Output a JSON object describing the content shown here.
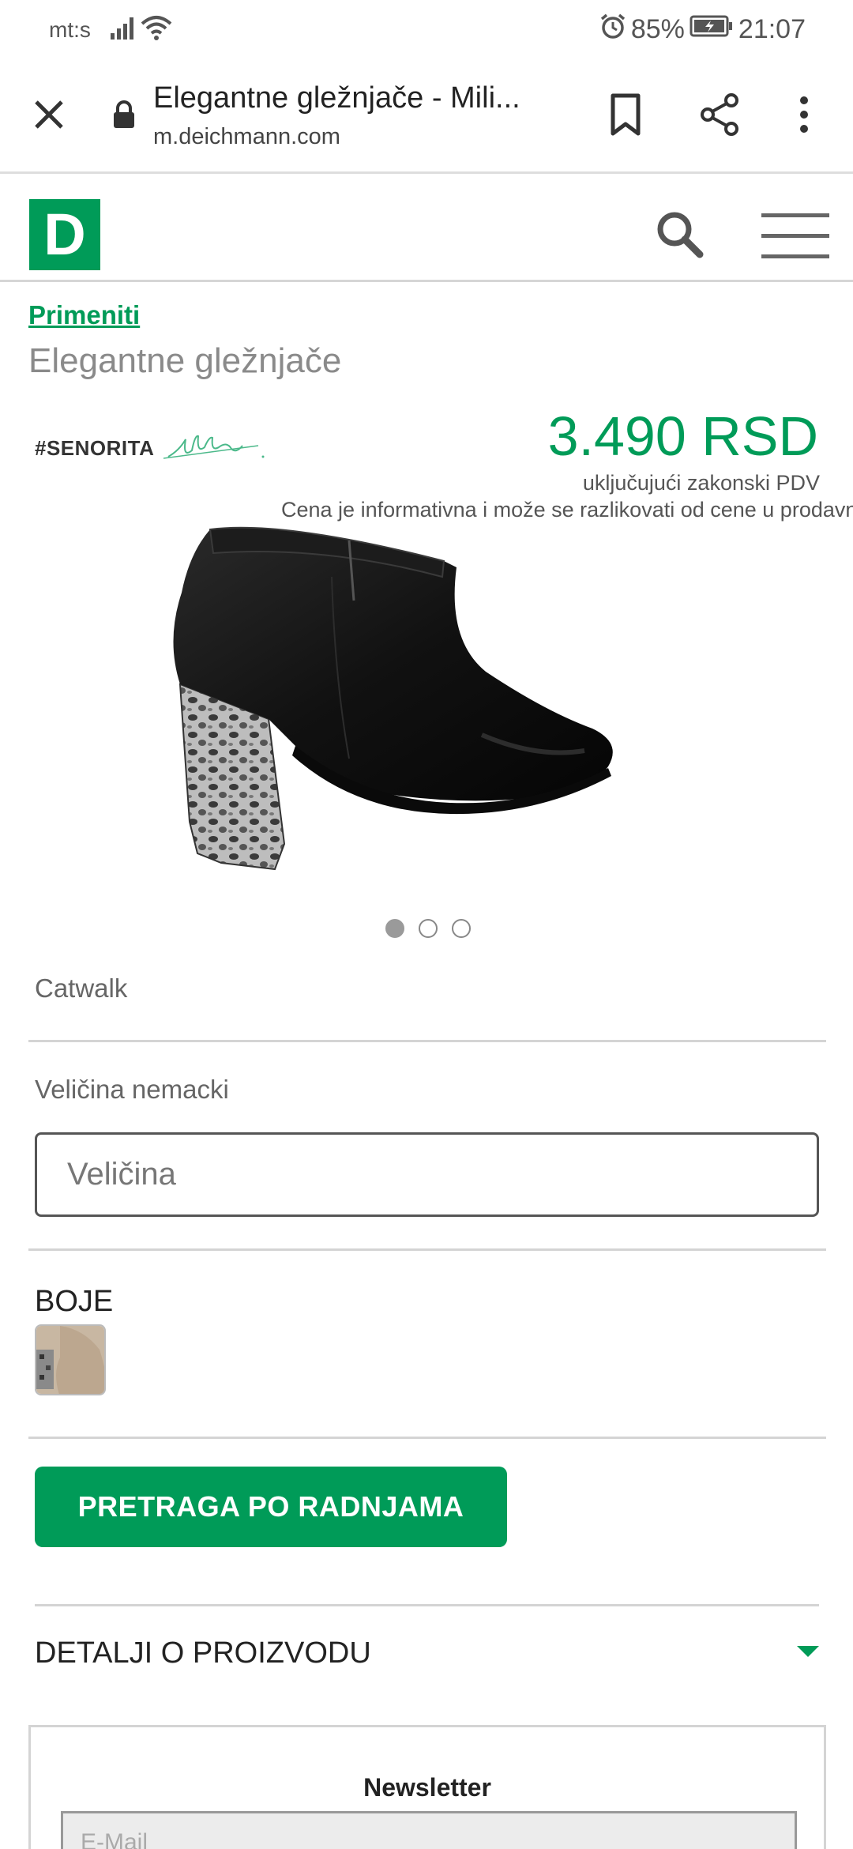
{
  "status_bar": {
    "carrier": "mt:s",
    "battery": "85%",
    "time": "21:07"
  },
  "browser": {
    "tab_title": "Elegantne gležnjače - Mili...",
    "url": "m.deichmann.com"
  },
  "site": {
    "logo_letter": "D",
    "brand_color": "#009b58"
  },
  "product": {
    "breadcrumb": "Primeniti",
    "name": "Elegantne gležnjače",
    "brand_tag": "#SENORITA",
    "price": "3.490 RSD",
    "vat_note": "uključujući zakonski PDV",
    "price_note": "Cena je informativna i može se razlikovati od cene u prodavnici",
    "brand": "Catwalk",
    "image_count": 3,
    "active_image": 1
  },
  "size": {
    "label": "Veličina nemacki",
    "placeholder": "Veličina"
  },
  "colors": {
    "label": "BOJE"
  },
  "store_button": {
    "label": "PRETRAGA PO RADNJAMA"
  },
  "details": {
    "label": "DETALJI O PROIZVODU"
  },
  "newsletter": {
    "title": "Newsletter",
    "placeholder": "E-Mail"
  },
  "icons": {
    "close": "close-icon",
    "lock": "lock-icon",
    "bookmark": "bookmark-icon",
    "share": "share-icon",
    "more": "more-vert-icon",
    "search": "search-icon",
    "menu": "hamburger-menu-icon",
    "chevron": "chevron-down-icon"
  }
}
